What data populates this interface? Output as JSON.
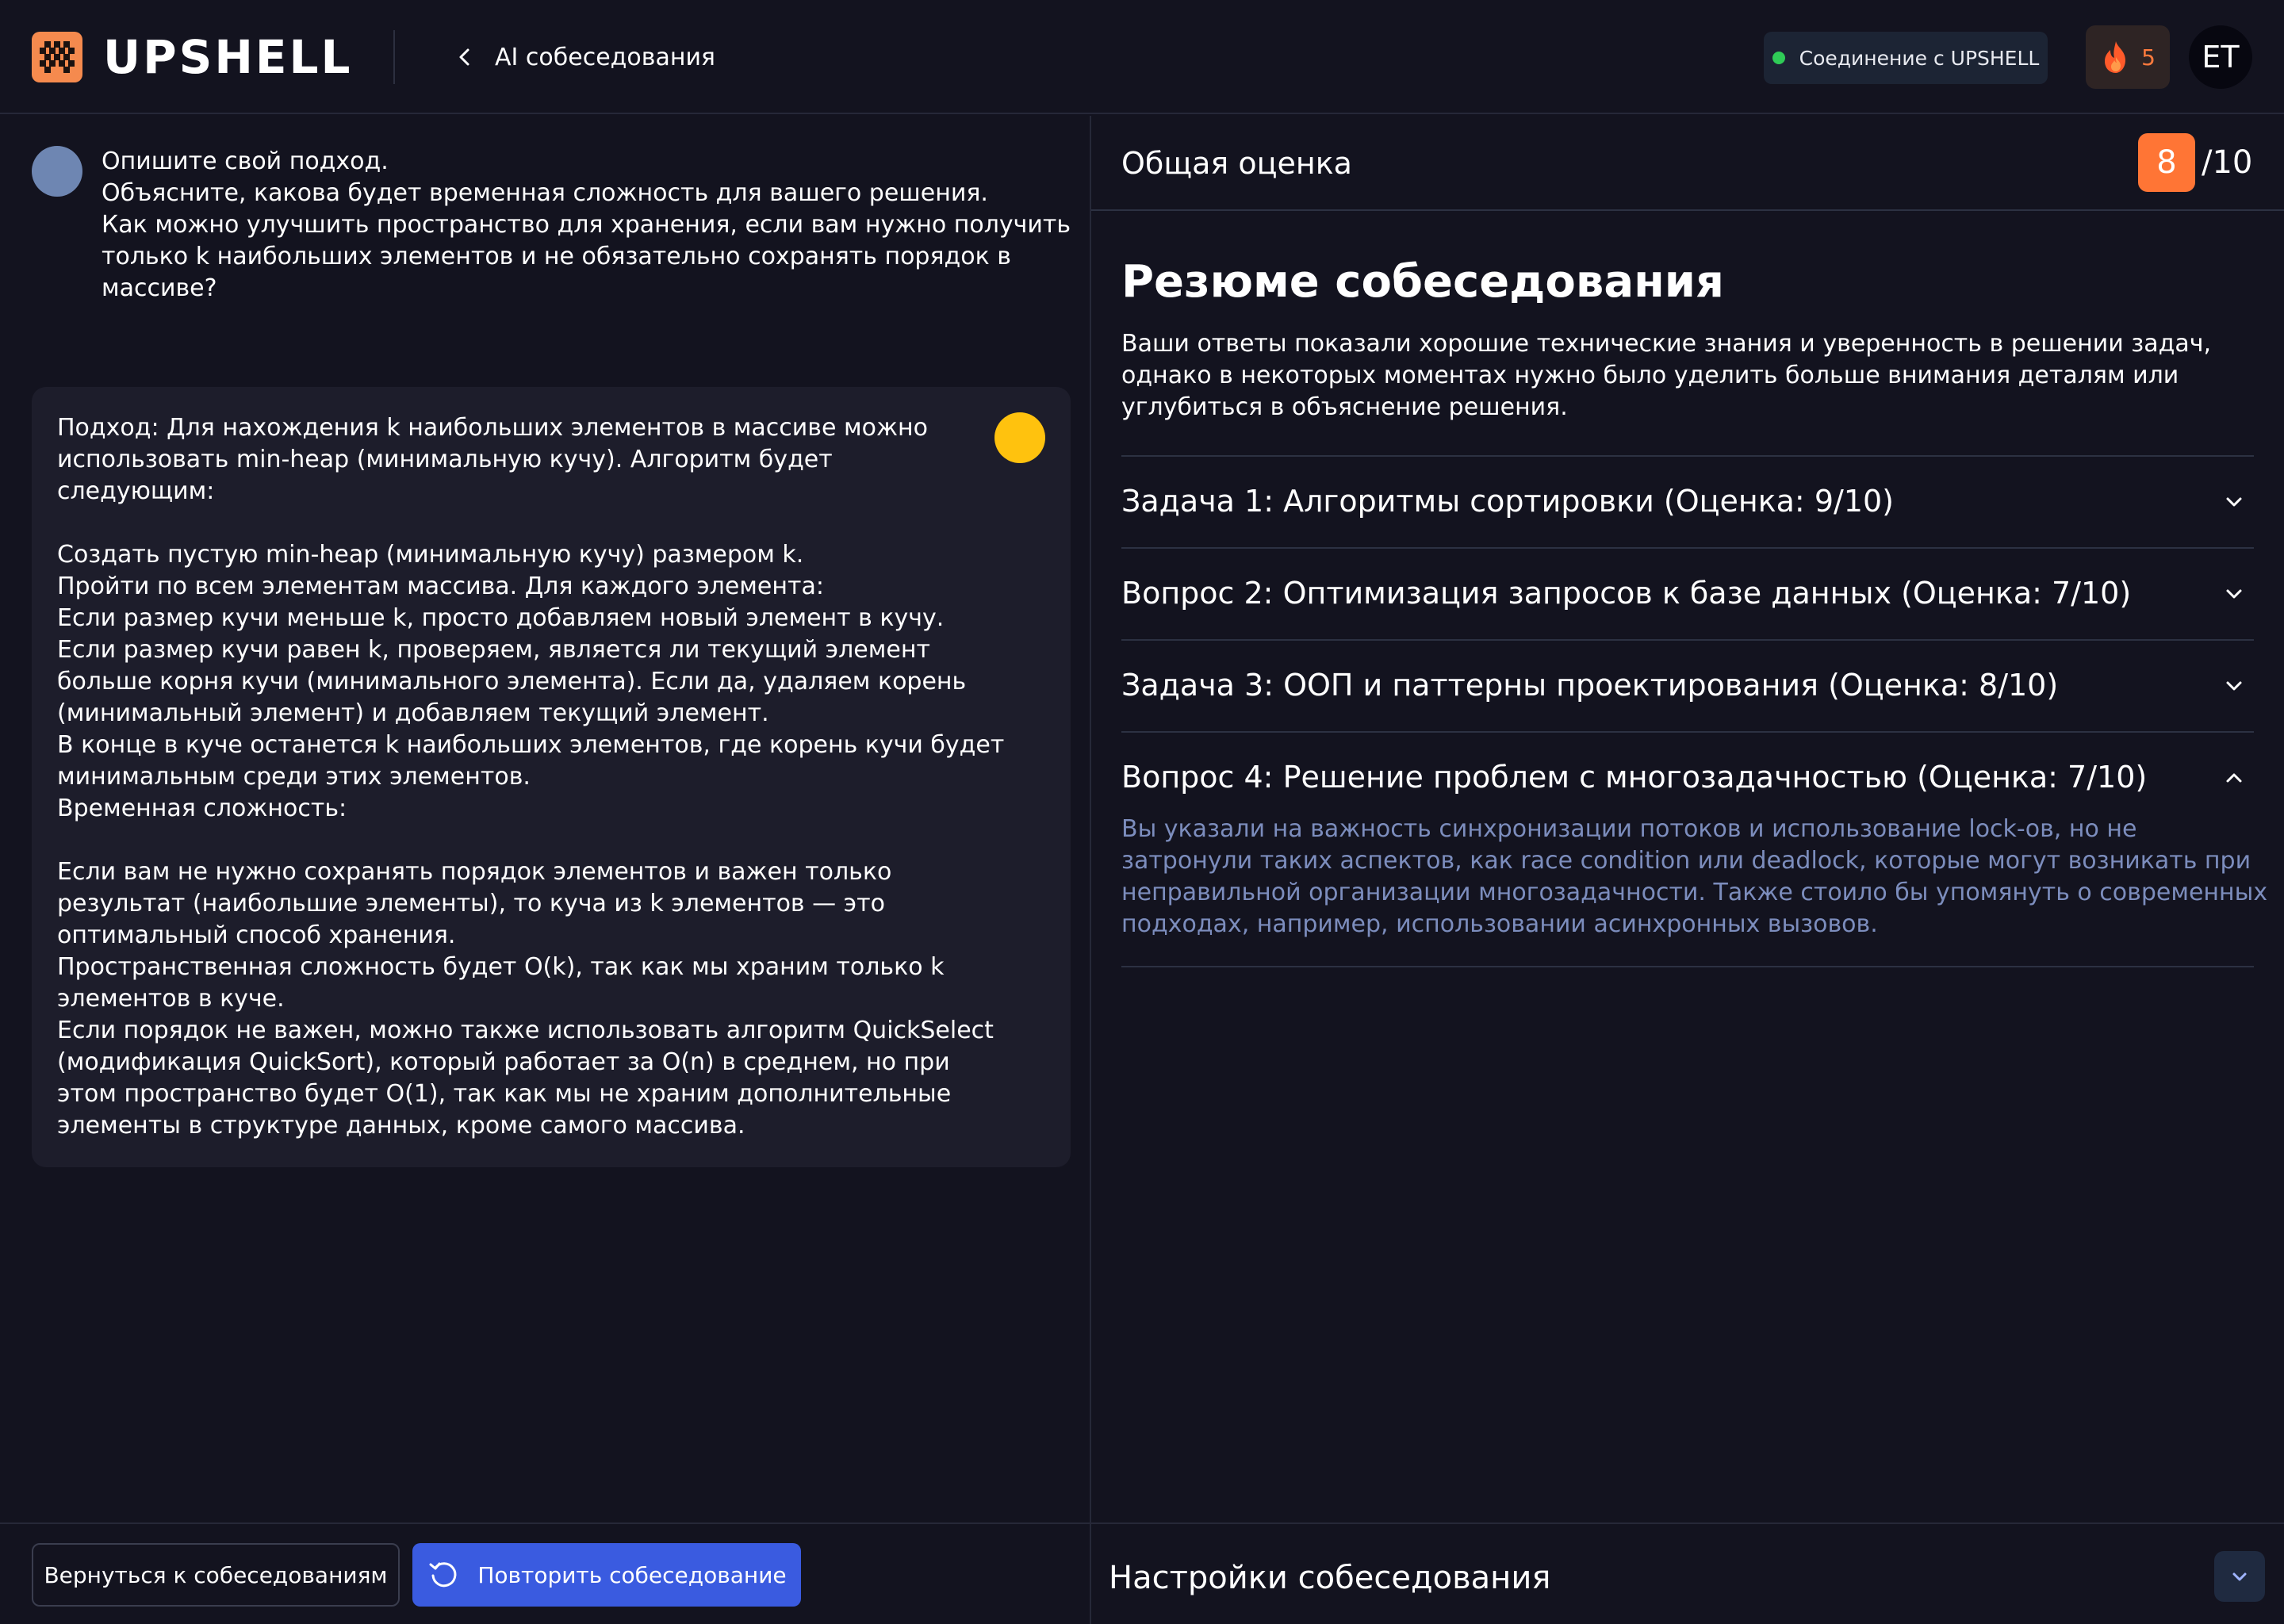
{
  "header": {
    "brand": "UPSHELL",
    "logo_icon": "upshell-logo-icon",
    "back_link": {
      "label": "AI собеседования",
      "icon": "chevron-left-icon"
    },
    "connection": {
      "label": "Соединение с UPSHELL",
      "status_color": "#2fcc57"
    },
    "streak": {
      "count": "5",
      "icon": "fire-icon",
      "color": "#ff7a3d"
    },
    "user_initials": "ET"
  },
  "question": {
    "lines": [
      "Опишите свой подход.",
      "Объясните, какова будет временная сложность для вашего решения.",
      "Как можно улучшить пространство для хранения, если вам нужно получить",
      "только k наибольших элементов и не обязательно сохранять порядок в",
      "массиве?"
    ]
  },
  "answer": {
    "lines": [
      "Подход: Для нахождения k наибольших элементов в массиве можно",
      "использовать min-heap (минимальную кучу). Алгоритм будет",
      "следующим:",
      "",
      "Создать пустую min-heap (минимальную кучу) размером k.",
      "Пройти по всем элементам массива. Для каждого элемента:",
      "Если размер кучи меньше k, просто добавляем новый элемент в кучу.",
      "Если размер кучи равен k, проверяем, является ли текущий элемент",
      "больше корня кучи (минимального элемента). Если да, удаляем корень",
      "(минимальный элемент) и добавляем текущий элемент.",
      "В конце в куче останется k наибольших элементов, где корень кучи будет",
      "минимальным среди этих элементов.",
      "Временная сложность:",
      "",
      "Если вам не нужно сохранять порядок элементов и важен только",
      "результат (наибольшие элементы), то куча из k элементов — это",
      "оптимальный способ хранения.",
      "Пространственная сложность будет O(k), так как мы храним только k",
      "элементов в куче.",
      "Если порядок не важен, можно также использовать алгоритм QuickSelect",
      "(модификация QuickSort), который работает за O(n) в среднем, но при",
      "этом пространство будет O(1), так как мы не храним дополнительные",
      "элементы в структуре данных, кроме самого массива."
    ]
  },
  "score": {
    "label": "Общая оценка",
    "value": "8",
    "total": "/10"
  },
  "summary": {
    "title": "Резюме собеседования",
    "lines": [
      "Ваши ответы показали хорошие технические знания и уверенность в решении задач,",
      "однако в некоторых моментах нужно было уделить больше внимания деталям или",
      "углубиться в объяснение решения."
    ]
  },
  "accordion": [
    {
      "title": "Задача 1: Алгоритмы сортировки (Оценка: 9/10)",
      "expanded": false
    },
    {
      "title": "Вопрос 2: Оптимизация запросов к базе данных (Оценка: 7/10)",
      "expanded": false
    },
    {
      "title": "Задача 3: ООП и паттерны проектирования (Оценка: 8/10)",
      "expanded": false
    },
    {
      "title": "Вопрос 4: Решение проблем с многозадачностью (Оценка: 7/10)",
      "expanded": true,
      "body_lines": [
        "Вы указали на важность синхронизации потоков и использование lock-ов, но не",
        "затронули таких аспектов, как race condition или deadlock, которые могут возникать при",
        "неправильной организации многозадачности. Также стоило бы упомянуть о современных",
        "подходах, например, использовании асинхронных вызовов."
      ]
    }
  ],
  "footer": {
    "back_button": "Вернуться к собеседованиям",
    "retry_button": "Повторить собеседование",
    "retry_icon": "refresh-icon",
    "settings_label": "Настройки собеседования",
    "settings_icon": "chevron-down-icon"
  },
  "colors": {
    "background": "#13131f",
    "accent_blue": "#3a5be0",
    "score_orange": "#ff7535",
    "muted_blue_text": "#7c8dbd",
    "answer_indicator": "#ffc20e"
  }
}
